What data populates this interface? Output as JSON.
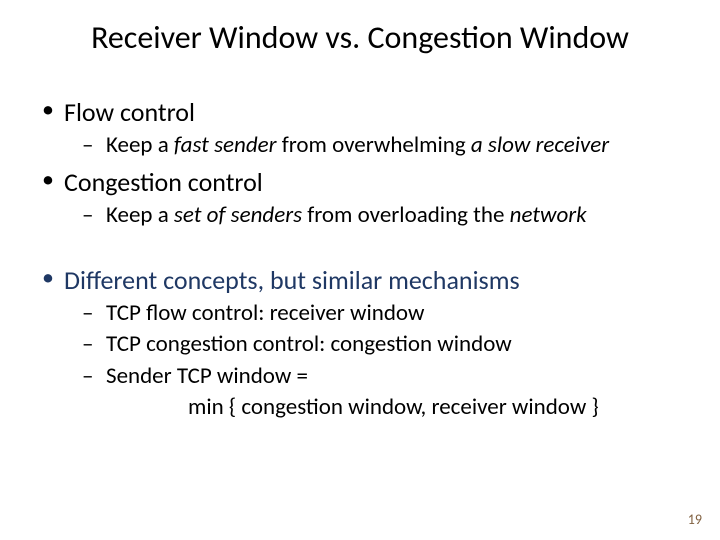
{
  "title": "Receiver Window vs. Congestion Window",
  "bullets": {
    "flow_control": "Flow control",
    "flow_sub_a": "Keep a ",
    "flow_sub_b": "fast sender",
    "flow_sub_c": " from overwhelming ",
    "flow_sub_d": "a slow receiver",
    "cong_control": "Congestion control",
    "cong_sub_a": "Keep a ",
    "cong_sub_b": "set of senders",
    "cong_sub_c": " from overloading the ",
    "cong_sub_d": "network",
    "diff": "Different concepts, but similar mechanisms",
    "tcp_flow": "TCP flow control:  receiver window",
    "tcp_cong": "TCP congestion control:  congestion window",
    "sender_win": "Sender TCP window =",
    "formula": "min { congestion window, receiver window }"
  },
  "page_number": "19"
}
